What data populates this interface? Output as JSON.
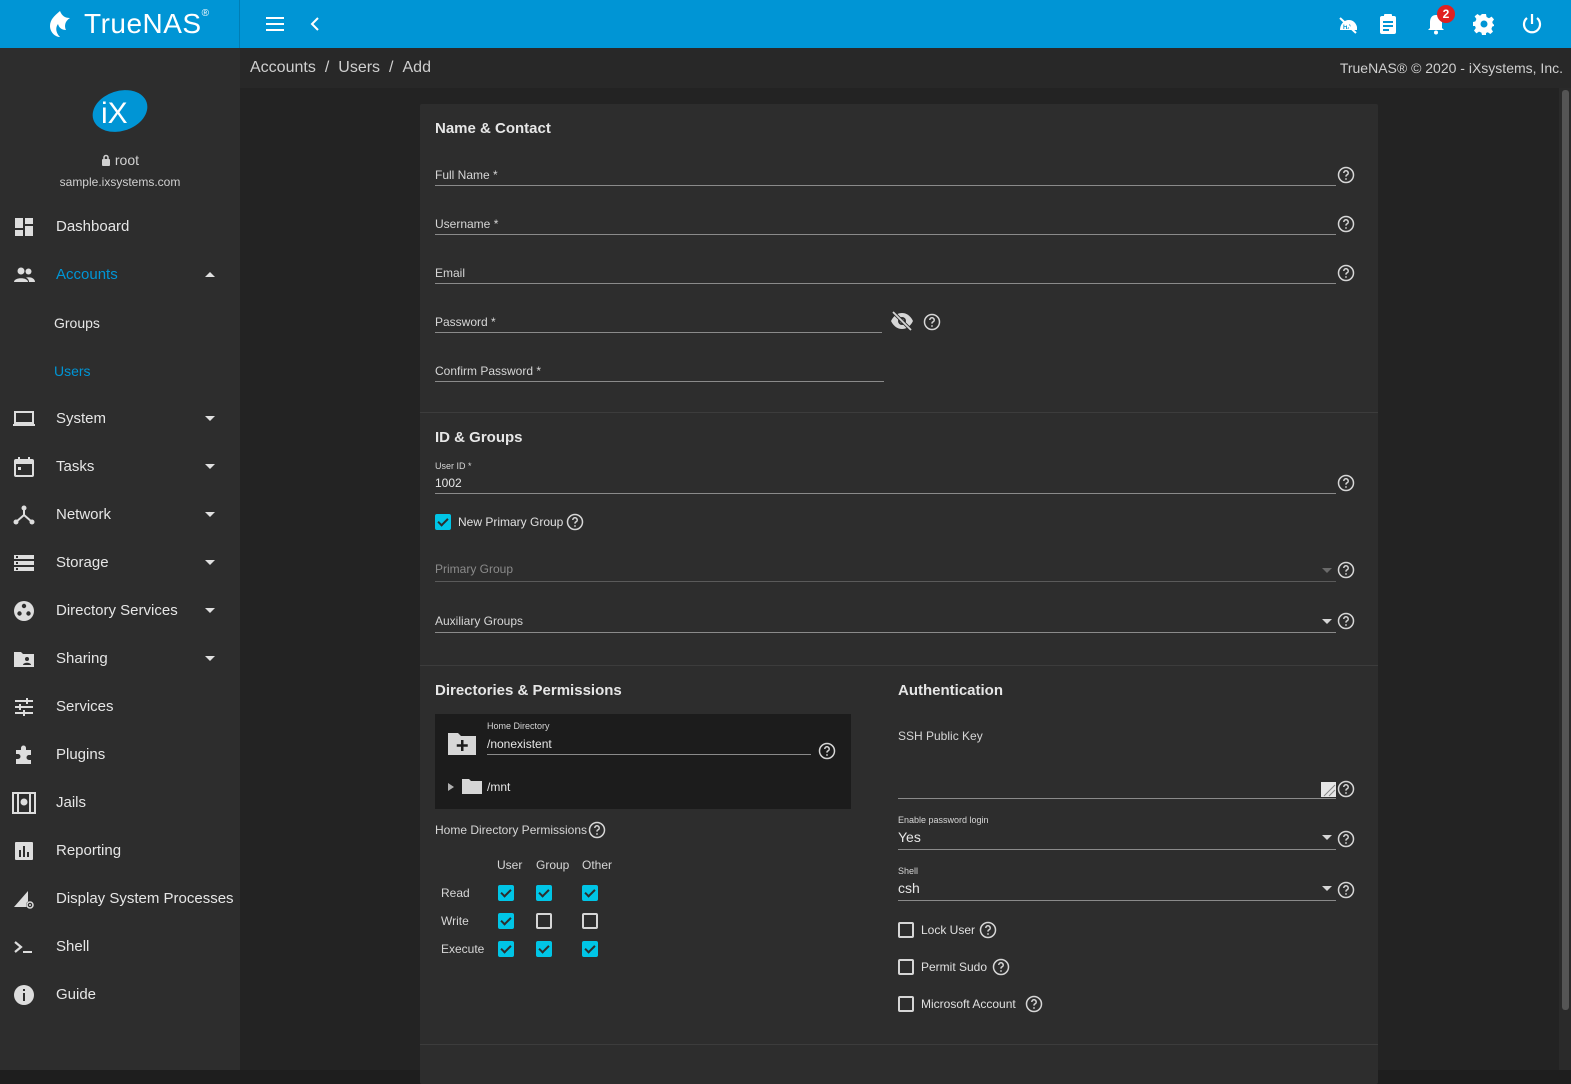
{
  "topbar": {
    "brand": "TrueNAS",
    "brand_mark": "®",
    "notifications_count": "2",
    "icons": [
      "menu-icon",
      "back-chevron-icon",
      "ha-status-icon",
      "task-manager-icon",
      "bell-icon",
      "gear-icon",
      "power-icon"
    ]
  },
  "sidebar": {
    "user": "root",
    "hostname": "sample.ixsystems.com",
    "items": [
      {
        "label": "Dashboard",
        "icon": "dashboard-icon"
      },
      {
        "label": "Accounts",
        "icon": "accounts-icon"
      },
      {
        "label": "Groups",
        "icon": ""
      },
      {
        "label": "Users",
        "icon": ""
      },
      {
        "label": "System",
        "icon": "laptop-icon"
      },
      {
        "label": "Tasks",
        "icon": "calendar-icon"
      },
      {
        "label": "Network",
        "icon": "network-icon"
      },
      {
        "label": "Storage",
        "icon": "storage-icon"
      },
      {
        "label": "Directory Services",
        "icon": "directory-services-icon"
      },
      {
        "label": "Sharing",
        "icon": "sharing-icon"
      },
      {
        "label": "Services",
        "icon": "services-icon"
      },
      {
        "label": "Plugins",
        "icon": "puzzle-icon"
      },
      {
        "label": "Jails",
        "icon": "jail-icon"
      },
      {
        "label": "Reporting",
        "icon": "chart-icon"
      },
      {
        "label": "Display System Processes",
        "icon": "processes-icon"
      },
      {
        "label": "Shell",
        "icon": "terminal-icon"
      },
      {
        "label": "Guide",
        "icon": "info-icon"
      }
    ]
  },
  "breadcrumb": {
    "items": [
      "Accounts",
      "Users",
      "Add"
    ],
    "separator": "/"
  },
  "copyright": "TrueNAS® © 2020 - iXsystems, Inc.",
  "form": {
    "name_contact": {
      "title": "Name & Contact",
      "full_name_label": "Full Name *",
      "username_label": "Username *",
      "email_label": "Email",
      "password_label": "Password *",
      "confirm_password_label": "Confirm Password *"
    },
    "id_groups": {
      "title": "ID & Groups",
      "user_id_label": "User ID *",
      "user_id_value": "1002",
      "new_primary_group_label": "New Primary Group",
      "new_primary_group_checked": true,
      "primary_group_label": "Primary Group",
      "auxiliary_groups_label": "Auxiliary Groups"
    },
    "directories": {
      "title": "Directories & Permissions",
      "home_directory_label": "Home Directory",
      "home_directory_value": "/nonexistent",
      "tree_root": "/mnt",
      "permissions_label": "Home Directory Permissions",
      "columns": [
        "User",
        "Group",
        "Other"
      ],
      "rows": [
        {
          "label": "Read",
          "values": [
            true,
            true,
            true
          ]
        },
        {
          "label": "Write",
          "values": [
            true,
            false,
            false
          ]
        },
        {
          "label": "Execute",
          "values": [
            true,
            true,
            true
          ]
        }
      ]
    },
    "authentication": {
      "title": "Authentication",
      "ssh_key_label": "SSH Public Key",
      "password_login_label": "Enable password login",
      "password_login_value": "Yes",
      "shell_label": "Shell",
      "shell_value": "csh",
      "lock_user_label": "Lock User",
      "permit_sudo_label": "Permit Sudo",
      "microsoft_account_label": "Microsoft Account"
    }
  },
  "colors": {
    "accent": "#0095d5",
    "checkbox": "#00c5e6",
    "badge": "#e02020"
  }
}
